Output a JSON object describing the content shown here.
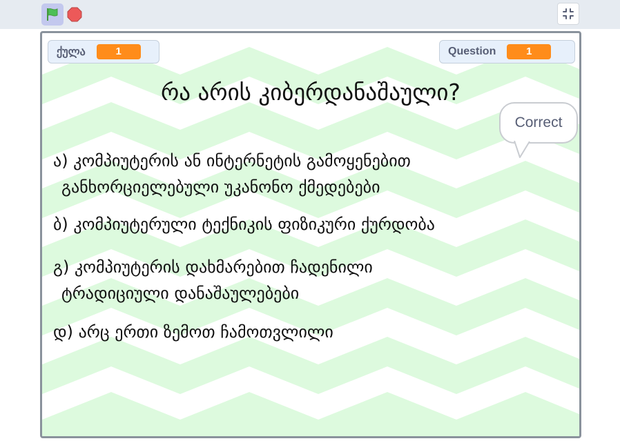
{
  "toolbar": {
    "green_flag_icon": "green-flag-icon",
    "stop_icon": "stop-icon",
    "fullscreen_icon": "exit-fullscreen-icon"
  },
  "monitors": {
    "score": {
      "label": "ქულა",
      "value": "1"
    },
    "question": {
      "label": "Question",
      "value": "1"
    }
  },
  "quiz": {
    "question": "რა არის კიბერდანაშაული?",
    "answers": {
      "a": {
        "line1": "ა) კომპიუტერის ან ინტერნეტის გამოყენებით",
        "line2": "განხორციელებული უკანონო ქმედებები"
      },
      "b": {
        "line1": "ბ) კომპიუტერული ტექნიკის ფიზიკური ქურდობა"
      },
      "c": {
        "line1": "გ) კომპიუტერის დახმარებით ჩადენილი",
        "line2": "ტრადიციული დანაშაულებები"
      },
      "d": {
        "line1": "დ) არც ერთი ზემოთ ჩამოთვლილი"
      }
    }
  },
  "speech_bubble": {
    "text": "Correct"
  },
  "colors": {
    "stage_border": "#8a929c",
    "zigzag": "#ddfade",
    "monitor_value": "#ff8c1a",
    "flag_active_bg": "#c3c8ee"
  }
}
